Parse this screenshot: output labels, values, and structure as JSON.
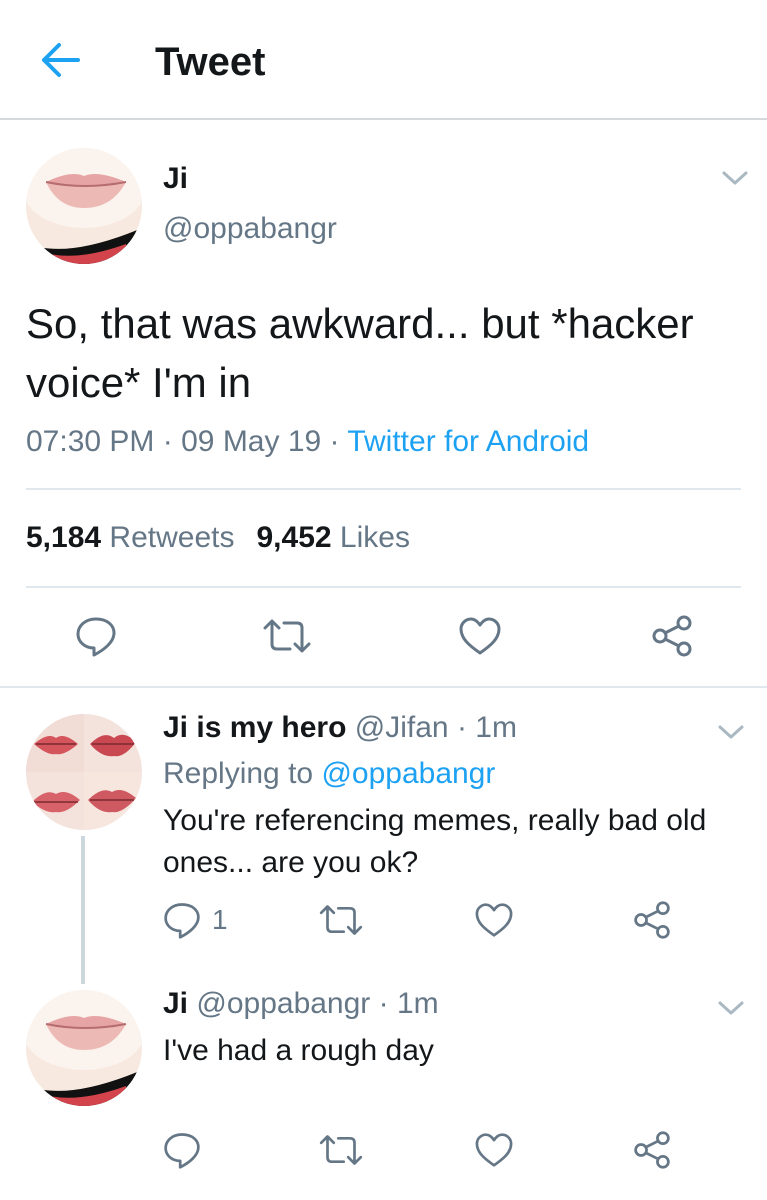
{
  "header": {
    "title": "Tweet"
  },
  "main_tweet": {
    "name": "Ji",
    "handle": "@oppabangr",
    "text": "So, that was awkward... but *hacker voice* I'm in",
    "time": "07:30 PM",
    "date": "09 May 19",
    "source": "Twitter for Android",
    "retweets_count": "5,184",
    "retweets_label": "Retweets",
    "likes_count": "9,452",
    "likes_label": "Likes"
  },
  "replies": [
    {
      "name": "Ji is my hero",
      "handle": "@Jifan",
      "time": "1m",
      "replying_label": "Replying to",
      "replying_to": "@oppabangr",
      "text": "You're referencing memes, really bad old ones... are you ok?",
      "reply_count": "1"
    },
    {
      "name": "Ji",
      "handle": "@oppabangr",
      "time": "1m",
      "text": "I've had a rough day"
    }
  ],
  "icons": [
    "back-arrow-icon",
    "chevron-down-icon",
    "reply-icon",
    "retweet-icon",
    "like-icon",
    "share-icon"
  ],
  "colors": {
    "accent": "#1da1f2",
    "secondary_text": "#657786",
    "icon": "#657786",
    "divider": "#e1e8ed"
  },
  "dot": "·"
}
